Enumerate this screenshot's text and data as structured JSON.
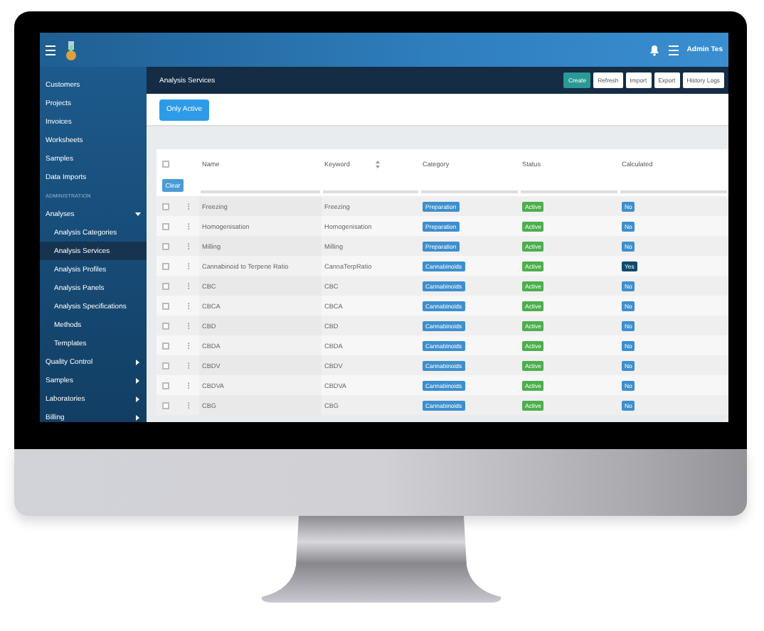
{
  "topbar": {
    "user": "Admin Tes"
  },
  "sidebar": {
    "items": [
      {
        "label": "Customers",
        "kind": "link",
        "selected": false
      },
      {
        "label": "Projects",
        "kind": "link",
        "selected": false
      },
      {
        "label": "Invoices",
        "kind": "link",
        "selected": false
      },
      {
        "label": "Worksheets",
        "kind": "link",
        "selected": false
      },
      {
        "label": "Samples",
        "kind": "link",
        "selected": false
      },
      {
        "label": "Data Imports",
        "kind": "link",
        "selected": false
      },
      {
        "label": "ADMINISTRATION",
        "kind": "heading"
      },
      {
        "label": "Analyses",
        "kind": "group",
        "selected": false,
        "expanded": true
      },
      {
        "label": "Analysis Categories",
        "kind": "sub",
        "selected": false
      },
      {
        "label": "Analysis Services",
        "kind": "sub",
        "selected": true
      },
      {
        "label": "Analysis Profiles",
        "kind": "sub",
        "selected": false
      },
      {
        "label": "Analysis Panels",
        "kind": "sub",
        "selected": false
      },
      {
        "label": "Analysis Specifications",
        "kind": "sub",
        "selected": false
      },
      {
        "label": "Methods",
        "kind": "sub",
        "selected": false
      },
      {
        "label": "Templates",
        "kind": "sub",
        "selected": false
      },
      {
        "label": "Quality Control",
        "kind": "group",
        "selected": false,
        "expanded": false
      },
      {
        "label": "Samples",
        "kind": "group",
        "selected": false,
        "expanded": false
      },
      {
        "label": "Laboratories",
        "kind": "group",
        "selected": false,
        "expanded": false
      },
      {
        "label": "Billing",
        "kind": "group",
        "selected": false,
        "expanded": false
      }
    ]
  },
  "page": {
    "title": "Analysis Services",
    "actions": [
      {
        "label": "Create",
        "kind": "primary"
      },
      {
        "label": "Refresh",
        "kind": "plain"
      },
      {
        "label": "Import",
        "kind": "plain"
      },
      {
        "label": "Export",
        "kind": "plain"
      },
      {
        "label": "History Logs",
        "kind": "plain"
      }
    ],
    "filter_button": "Only Active"
  },
  "table": {
    "select_all_checked": false,
    "clear_button": "Clear",
    "columns": [
      "Name",
      "Keyword",
      "Category",
      "Status",
      "Calculated"
    ],
    "rows": [
      {
        "checked": false,
        "name": "Freezing",
        "keyword": "Freezing",
        "category": "Preparation",
        "status": "Active",
        "calculated": {
          "label": "No",
          "on": false
        }
      },
      {
        "checked": false,
        "name": "Homogenisation",
        "keyword": "Homogenisation",
        "category": "Preparation",
        "status": "Active",
        "calculated": {
          "label": "No",
          "on": false
        }
      },
      {
        "checked": false,
        "name": "Milling",
        "keyword": "Milling",
        "category": "Preparation",
        "status": "Active",
        "calculated": {
          "label": "No",
          "on": false
        }
      },
      {
        "checked": false,
        "name": "Cannabinoid to Terpene Ratio",
        "keyword": "CannaTerpRatio",
        "category": "Cannabinoids",
        "status": "Active",
        "calculated": {
          "label": "Yes",
          "on": true
        }
      },
      {
        "checked": false,
        "name": "CBC",
        "keyword": "CBC",
        "category": "Cannabinoids",
        "status": "Active",
        "calculated": {
          "label": "No",
          "on": false
        }
      },
      {
        "checked": false,
        "name": "CBCA",
        "keyword": "CBCA",
        "category": "Cannabinoids",
        "status": "Active",
        "calculated": {
          "label": "No",
          "on": false
        }
      },
      {
        "checked": false,
        "name": "CBD",
        "keyword": "CBD",
        "category": "Cannabinoids",
        "status": "Active",
        "calculated": {
          "label": "No",
          "on": false
        }
      },
      {
        "checked": false,
        "name": "CBDA",
        "keyword": "CBDA",
        "category": "Cannabinoids",
        "status": "Active",
        "calculated": {
          "label": "No",
          "on": false
        }
      },
      {
        "checked": false,
        "name": "CBDV",
        "keyword": "CBDV",
        "category": "Cannabinoids",
        "status": "Active",
        "calculated": {
          "label": "No",
          "on": false
        }
      },
      {
        "checked": false,
        "name": "CBDVA",
        "keyword": "CBDVA",
        "category": "Cannabinoids",
        "status": "Active",
        "calculated": {
          "label": "No",
          "on": false
        }
      },
      {
        "checked": false,
        "name": "CBG",
        "keyword": "CBG",
        "category": "Cannabinoids",
        "status": "Active",
        "calculated": {
          "label": "No",
          "on": false
        }
      }
    ]
  }
}
